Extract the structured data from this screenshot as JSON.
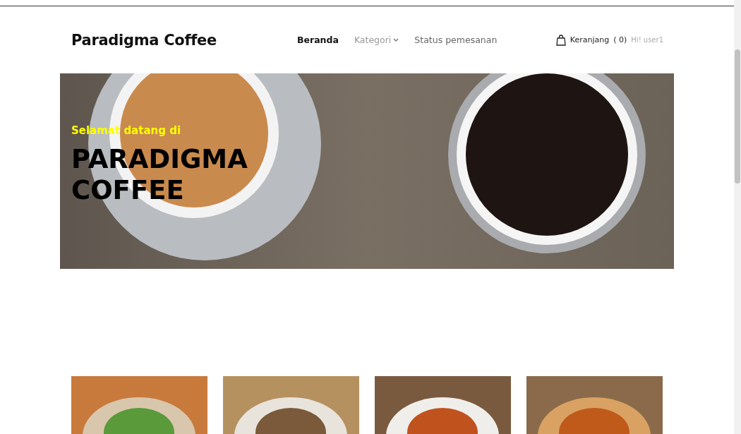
{
  "brand": "Paradigma Coffee",
  "nav": [
    {
      "label": "Beranda",
      "selected": true,
      "kind": "link"
    },
    {
      "label": "Kategori",
      "selected": false,
      "kind": "dropdown"
    },
    {
      "label": "Status pemesanan",
      "selected": false,
      "kind": "link"
    }
  ],
  "cart": {
    "label": "Keranjang",
    "count": "( 0)",
    "greeting": "Hi! user1"
  },
  "hero": {
    "subtitle": "Selamat datang di",
    "title_lines": [
      "PARADIGMA",
      "COFFEE"
    ]
  },
  "products": [
    {
      "kind": "rice"
    },
    {
      "kind": "soup"
    },
    {
      "kind": "chicken"
    },
    {
      "kind": "tea"
    }
  ]
}
